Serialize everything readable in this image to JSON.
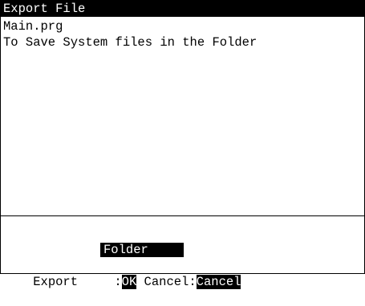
{
  "title": "Export File",
  "body_lines": [
    "Main.prg",
    "To Save System files in the Folder"
  ],
  "folder_label": "Folder",
  "export": {
    "label": "Export",
    "colon1": " :",
    "ok_label": "OK",
    "cancel_prefix": " Cancel:",
    "cancel_label": "Cancel"
  }
}
